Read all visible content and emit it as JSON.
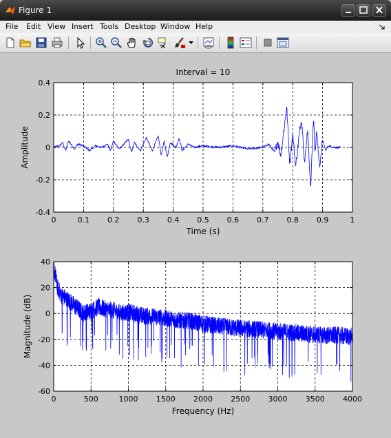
{
  "window": {
    "title": "Figure 1"
  },
  "menu": [
    "File",
    "Edit",
    "View",
    "Insert",
    "Tools",
    "Desktop",
    "Window",
    "Help"
  ],
  "toolbar": [
    "new-figure",
    "open-file",
    "save",
    "print",
    "edit-plot",
    "zoom-in",
    "zoom-out",
    "pan",
    "rotate-3d",
    "data-cursor",
    "brush",
    "brush-dropdown",
    "link-plot",
    "colorbar",
    "legend",
    "hide-plot-tools",
    "show-plot-tools"
  ],
  "chart_data": [
    {
      "type": "line",
      "title": "Interval = 10",
      "xlabel": "Time (s)",
      "ylabel": "Amplitude",
      "xlim": [
        0,
        1
      ],
      "ylim": [
        -0.4,
        0.4
      ],
      "xticks": [
        "0",
        "0.1",
        "0.2",
        "0.3",
        "0.4",
        "0.5",
        "0.6",
        "0.7",
        "0.8",
        "0.9",
        "1"
      ],
      "yticks": [
        "0.4",
        "0.2",
        "0",
        "-0.2",
        "-0.4"
      ],
      "grid": true,
      "color": "#0000ff",
      "series": [
        {
          "x": [
            0,
            0.02,
            0.03,
            0.04,
            0.05,
            0.07,
            0.08,
            0.1,
            0.12,
            0.14,
            0.16,
            0.18,
            0.19,
            0.2,
            0.22,
            0.25,
            0.26,
            0.27,
            0.29,
            0.31,
            0.33,
            0.35,
            0.36,
            0.37,
            0.38,
            0.39,
            0.41,
            0.42,
            0.43,
            0.45,
            0.47,
            0.5,
            0.55,
            0.6,
            0.65,
            0.7,
            0.72,
            0.74,
            0.75,
            0.76,
            0.77,
            0.78,
            0.79,
            0.8,
            0.81,
            0.82,
            0.83,
            0.84,
            0.85,
            0.86,
            0.87,
            0.875,
            0.88,
            0.89,
            0.9,
            0.91,
            0.92,
            0.94,
            0.96
          ],
          "y": [
            0.0,
            0.01,
            0.03,
            -0.02,
            0.04,
            -0.01,
            0.02,
            0.01,
            -0.02,
            0.01,
            0.0,
            0.02,
            -0.02,
            0.04,
            -0.01,
            0.05,
            -0.03,
            0.03,
            -0.02,
            0.06,
            -0.02,
            0.07,
            -0.05,
            0.04,
            -0.06,
            0.03,
            0.0,
            0.06,
            -0.02,
            0.02,
            0.0,
            0.01,
            0.0,
            0.01,
            -0.01,
            0.0,
            0.02,
            -0.03,
            0.04,
            -0.05,
            0.1,
            0.25,
            -0.1,
            0.08,
            -0.12,
            0.05,
            0.18,
            -0.1,
            0.12,
            -0.25,
            0.2,
            -0.05,
            0.1,
            -0.12,
            0.05,
            -0.02,
            0.01,
            0.0,
            0.0
          ]
        }
      ]
    },
    {
      "type": "line",
      "title": "",
      "xlabel": "Frequency (Hz)",
      "ylabel": "Magnitude (dB)",
      "xlim": [
        0,
        4000
      ],
      "ylim": [
        -60,
        40
      ],
      "xticks": [
        "0",
        "500",
        "1000",
        "1500",
        "2000",
        "2500",
        "3000",
        "3500",
        "4000"
      ],
      "yticks": [
        "40",
        "20",
        "0",
        "-20",
        "-40",
        "-60"
      ],
      "grid": true,
      "color": "#0000ff",
      "series": [
        {
          "x": [
            0,
            20,
            50,
            100,
            200,
            300,
            400,
            500,
            600,
            700,
            800,
            900,
            1000,
            1200,
            1400,
            1600,
            1800,
            2000,
            2200,
            2400,
            2600,
            2800,
            3000,
            3200,
            3400,
            3600,
            3800,
            4000
          ],
          "y": [
            36,
            30,
            20,
            14,
            10,
            5,
            0,
            2,
            5,
            3,
            2,
            0,
            1,
            -2,
            -3,
            -5,
            -6,
            -8,
            -10,
            -11,
            -12,
            -13,
            -14,
            -15,
            -16,
            -17,
            -17,
            -18
          ]
        }
      ]
    }
  ]
}
